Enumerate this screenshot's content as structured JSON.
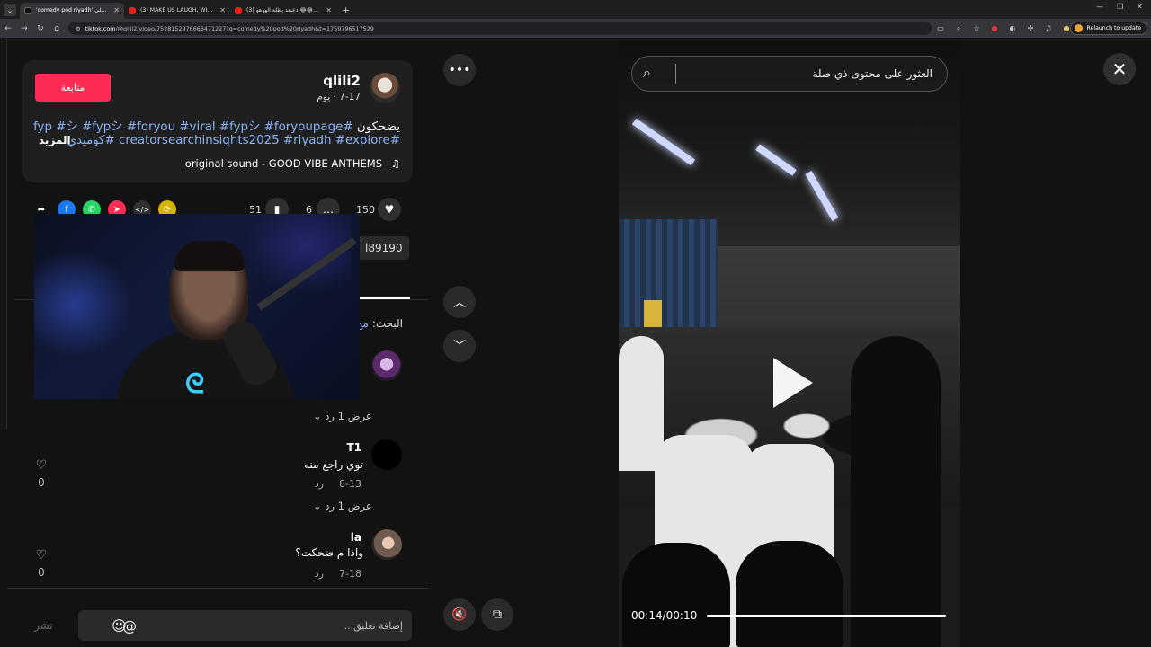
{
  "browser": {
    "tabs": [
      {
        "title": "'comedy pod riyadh' اعثر على",
        "icon": "tiktok-icon",
        "active": true
      },
      {
        "title": "(3) MAKE US LAUGH, WIN $10...",
        "icon": "youtube-icon",
        "active": false
      },
      {
        "title": "(3) دعبعد بطلة الهوهو 😂😂😂😂",
        "icon": "youtube-icon",
        "active": false
      }
    ],
    "url_host": "tiktok.com",
    "url_path": "/@qlili2/video/7528152976666471227?q=comedy%20pod%20riyadh&t=1759796517529",
    "relaunch_label": "Relaunch to update"
  },
  "post": {
    "username": "qlili2",
    "date": "7-17 · يوم",
    "follow_label": "متابعة",
    "caption_text": "يضحكون",
    "caption_tags_line1": "#fyp #シ #fypシ #foryou #viral #fypシ #foryoupage",
    "caption_tags_line2": "#creatorsearchinsights2025 #riyadh #explore #كوميدي",
    "caption_ellipsis": "...",
    "more_label": "المزيد",
    "music": "original sound - GOOD VIBE ANTHEMS",
    "likes": "150",
    "comments": "6",
    "saves": "51",
    "link_fragment": "l89190"
  },
  "comments_section": {
    "search_prefix": "البحث:",
    "search_term": "مخ",
    "comments": [
      {
        "name": "T1",
        "text": "توي راجع منه",
        "date": "8-13",
        "reply_label": "رد",
        "view_replies": "عرض 1 رد",
        "likes": "0"
      },
      {
        "name": "la",
        "text": "واذا م ضحكت؟",
        "date": "7-18",
        "reply_label": "رد",
        "likes": "0"
      }
    ],
    "first_view_replies": "عرض 1 رد"
  },
  "composer": {
    "placeholder": "إضافة تعليق...",
    "post_label": "نشر"
  },
  "video": {
    "search_placeholder": "العثور على محتوى ذي صلة",
    "current_time": "00:14",
    "duration": "00:10",
    "progress": 1.0
  },
  "colors": {
    "accent": "#fe2c55",
    "link": "#8ab4f8"
  }
}
